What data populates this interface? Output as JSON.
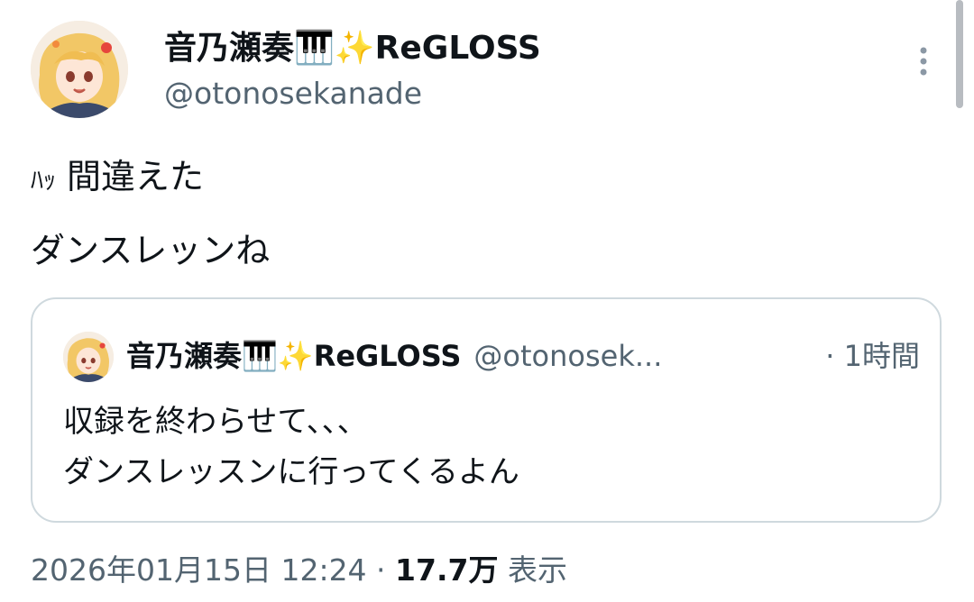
{
  "tweet": {
    "display_name": "音乃瀬奏🎹✨ReGLOSS",
    "handle": "@otonosekanade",
    "more_icon": "more-vertical-icon",
    "text_line1_small": "ﾊｯ",
    "text_line1": "間違えた",
    "text_line2": "ダンスレッンね"
  },
  "quote": {
    "display_name": "音乃瀬奏🎹✨ReGLOSS",
    "handle": "@otonosek...",
    "time": "· 1時間",
    "text_line1": "収録を終わらせて、、、",
    "text_line2": "ダンスレッスンに行ってくるよん"
  },
  "footer": {
    "datetime": "2026年01月15日 12:24 · ",
    "views": "17.7万",
    "views_label": " 表示"
  },
  "colors": {
    "text_primary": "#0f1419",
    "text_secondary": "#536471",
    "border": "#cfd9de"
  }
}
